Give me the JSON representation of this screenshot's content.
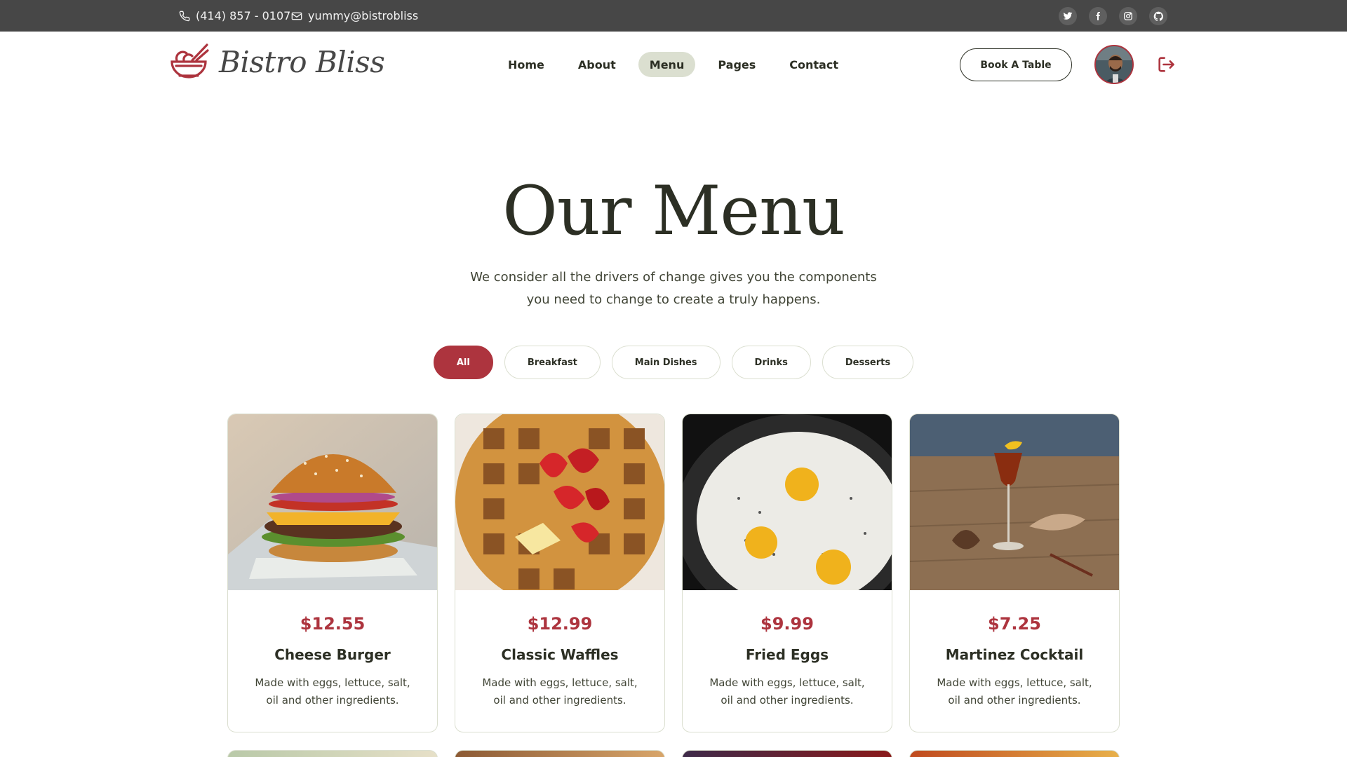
{
  "topbar": {
    "phone": "(414) 857 - 0107",
    "email": "yummy@bistrobliss",
    "socials": [
      "twitter-icon",
      "facebook-icon",
      "instagram-icon",
      "github-icon"
    ]
  },
  "header": {
    "brand": "Bistro Bliss",
    "nav": [
      {
        "label": "Home",
        "active": false
      },
      {
        "label": "About",
        "active": false
      },
      {
        "label": "Menu",
        "active": true
      },
      {
        "label": "Pages",
        "active": false
      },
      {
        "label": "Contact",
        "active": false
      }
    ],
    "cta": "Book A Table"
  },
  "hero": {
    "title": "Our Menu",
    "subtitle_line1": "We consider all the drivers of change gives you the components",
    "subtitle_line2": "you need to change to create a truly happens."
  },
  "filters": [
    {
      "label": "All",
      "active": true
    },
    {
      "label": "Breakfast",
      "active": false
    },
    {
      "label": "Main Dishes",
      "active": false
    },
    {
      "label": "Drinks",
      "active": false
    },
    {
      "label": "Desserts",
      "active": false
    }
  ],
  "menu": [
    {
      "price": "$12.55",
      "name": "Cheese Burger",
      "desc_line1": "Made with eggs, lettuce, salt,",
      "desc_line2": "oil and other ingredients."
    },
    {
      "price": "$12.99",
      "name": "Classic Waffles",
      "desc_line1": "Made with eggs, lettuce, salt,",
      "desc_line2": "oil and other ingredients."
    },
    {
      "price": "$9.99",
      "name": "Fried Eggs",
      "desc_line1": "Made with eggs, lettuce, salt,",
      "desc_line2": "oil and other ingredients."
    },
    {
      "price": "$7.25",
      "name": "Martinez Cocktail",
      "desc_line1": "Made with eggs, lettuce, salt,",
      "desc_line2": "oil and other ingredients."
    }
  ],
  "colors": {
    "accent": "#ad343e",
    "topbar": "#474747",
    "text": "#2c2f24",
    "nav_active": "#dbdfd0"
  }
}
